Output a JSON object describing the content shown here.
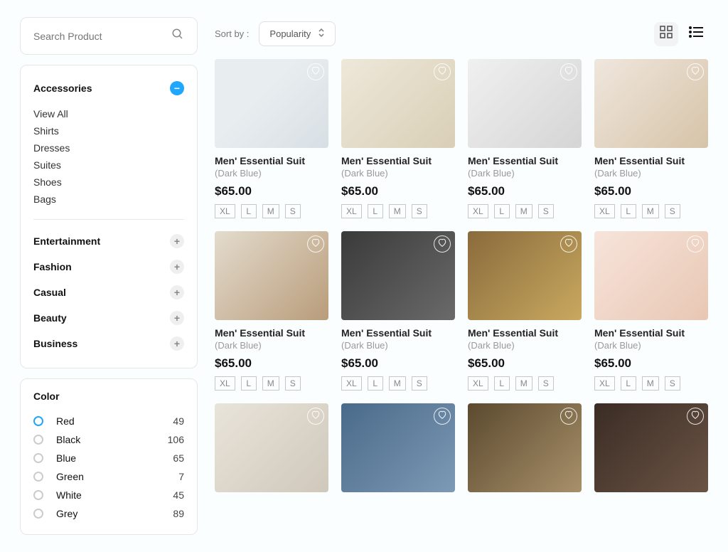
{
  "search": {
    "placeholder": "Search Product"
  },
  "categories": {
    "expanded": {
      "label": "Accessories",
      "action": "minus",
      "items": [
        "View All",
        "Shirts",
        "Dresses",
        "Suites",
        "Shoes",
        "Bags"
      ]
    },
    "collapsed": [
      {
        "label": "Entertainment"
      },
      {
        "label": "Fashion"
      },
      {
        "label": "Casual"
      },
      {
        "label": "Beauty"
      },
      {
        "label": "Business"
      }
    ]
  },
  "colorFilter": {
    "title": "Color",
    "options": [
      {
        "label": "Red",
        "count": "49",
        "selected": true
      },
      {
        "label": "Black",
        "count": "106",
        "selected": false
      },
      {
        "label": "Blue",
        "count": "65",
        "selected": false
      },
      {
        "label": "Green",
        "count": "7",
        "selected": false
      },
      {
        "label": "White",
        "count": "45",
        "selected": false
      },
      {
        "label": "Grey",
        "count": "89",
        "selected": false
      }
    ]
  },
  "sort": {
    "label": "Sort by :",
    "value": "Popularity"
  },
  "sizes": [
    "XL",
    "L",
    "M",
    "S"
  ],
  "product": {
    "name": "Men' Essential Suit",
    "sub": "(Dark Blue)",
    "price": "$65.00"
  },
  "productCount": 12
}
